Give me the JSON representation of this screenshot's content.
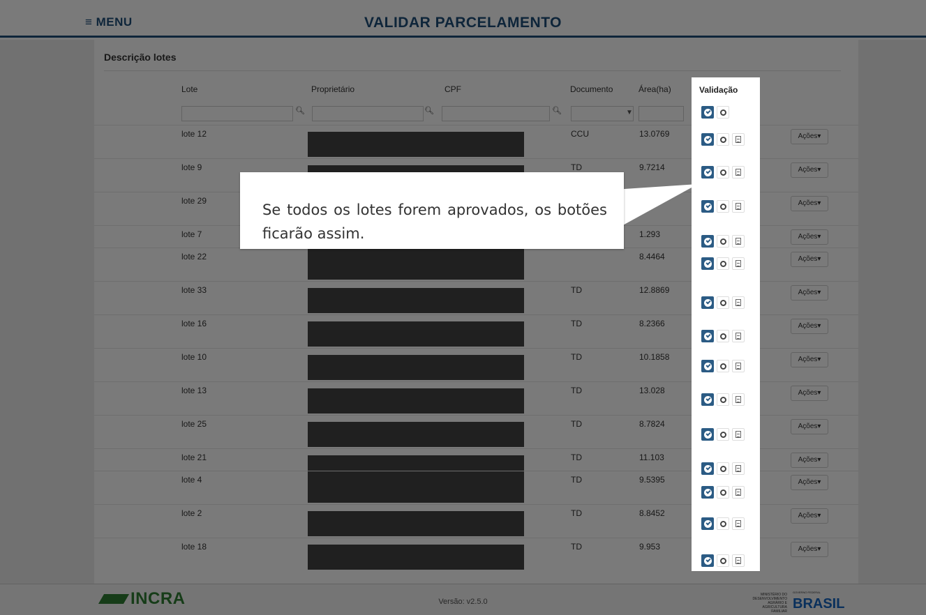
{
  "header": {
    "menu_label": "≡ MENU",
    "title": "VALIDAR PARCELAMENTO"
  },
  "card": {
    "title": "Descrição lotes"
  },
  "table": {
    "columns": {
      "lote": "Lote",
      "proprietario": "Proprietário",
      "cpf": "CPF",
      "documento": "Documento",
      "area": "Área(ha)",
      "validacao": "Validação"
    },
    "filter_icon": "search-icon",
    "rows": [
      {
        "lote": "lote 12",
        "documento": "CCU",
        "area": "13.0769"
      },
      {
        "lote": "lote 9",
        "documento": "TD",
        "area": "9.7214"
      },
      {
        "lote": "lote 29",
        "documento": "",
        "area": ""
      },
      {
        "lote": "lote 7",
        "documento": "",
        "area": "1.293"
      },
      {
        "lote": "lote 22",
        "documento": "",
        "area": "8.4464"
      },
      {
        "lote": "lote 33",
        "documento": "TD",
        "area": "12.8869"
      },
      {
        "lote": "lote 16",
        "documento": "TD",
        "area": "8.2366"
      },
      {
        "lote": "lote 10",
        "documento": "TD",
        "area": "10.1858"
      },
      {
        "lote": "lote 13",
        "documento": "TD",
        "area": "13.028"
      },
      {
        "lote": "lote 25",
        "documento": "TD",
        "area": "8.7824"
      },
      {
        "lote": "lote 21",
        "documento": "TD",
        "area": "11.103"
      },
      {
        "lote": "lote 4",
        "documento": "TD",
        "area": "9.5395"
      },
      {
        "lote": "lote 2",
        "documento": "TD",
        "area": "8.8452"
      },
      {
        "lote": "lote 18",
        "documento": "TD",
        "area": "9.953"
      }
    ],
    "acoes_label": "Ações▾"
  },
  "callout": {
    "text": "Se todos os lotes forem aprovados, os botões ficarão assim."
  },
  "footer": {
    "logo_text": "INCRA",
    "version": "Versão: v2.5.0",
    "gov_text": "MINISTÉRIO DO DESENVOLVIMENTO AGRÁRIO E AGRICULTURA FAMILIAR",
    "brasil_text": "BRASIL",
    "brasil_sub": "GOVERNO FEDERAL"
  },
  "colors": {
    "brand_blue": "#1f4e79",
    "validate_blue": "#2b5b84",
    "incra_green": "#2e7d32"
  }
}
